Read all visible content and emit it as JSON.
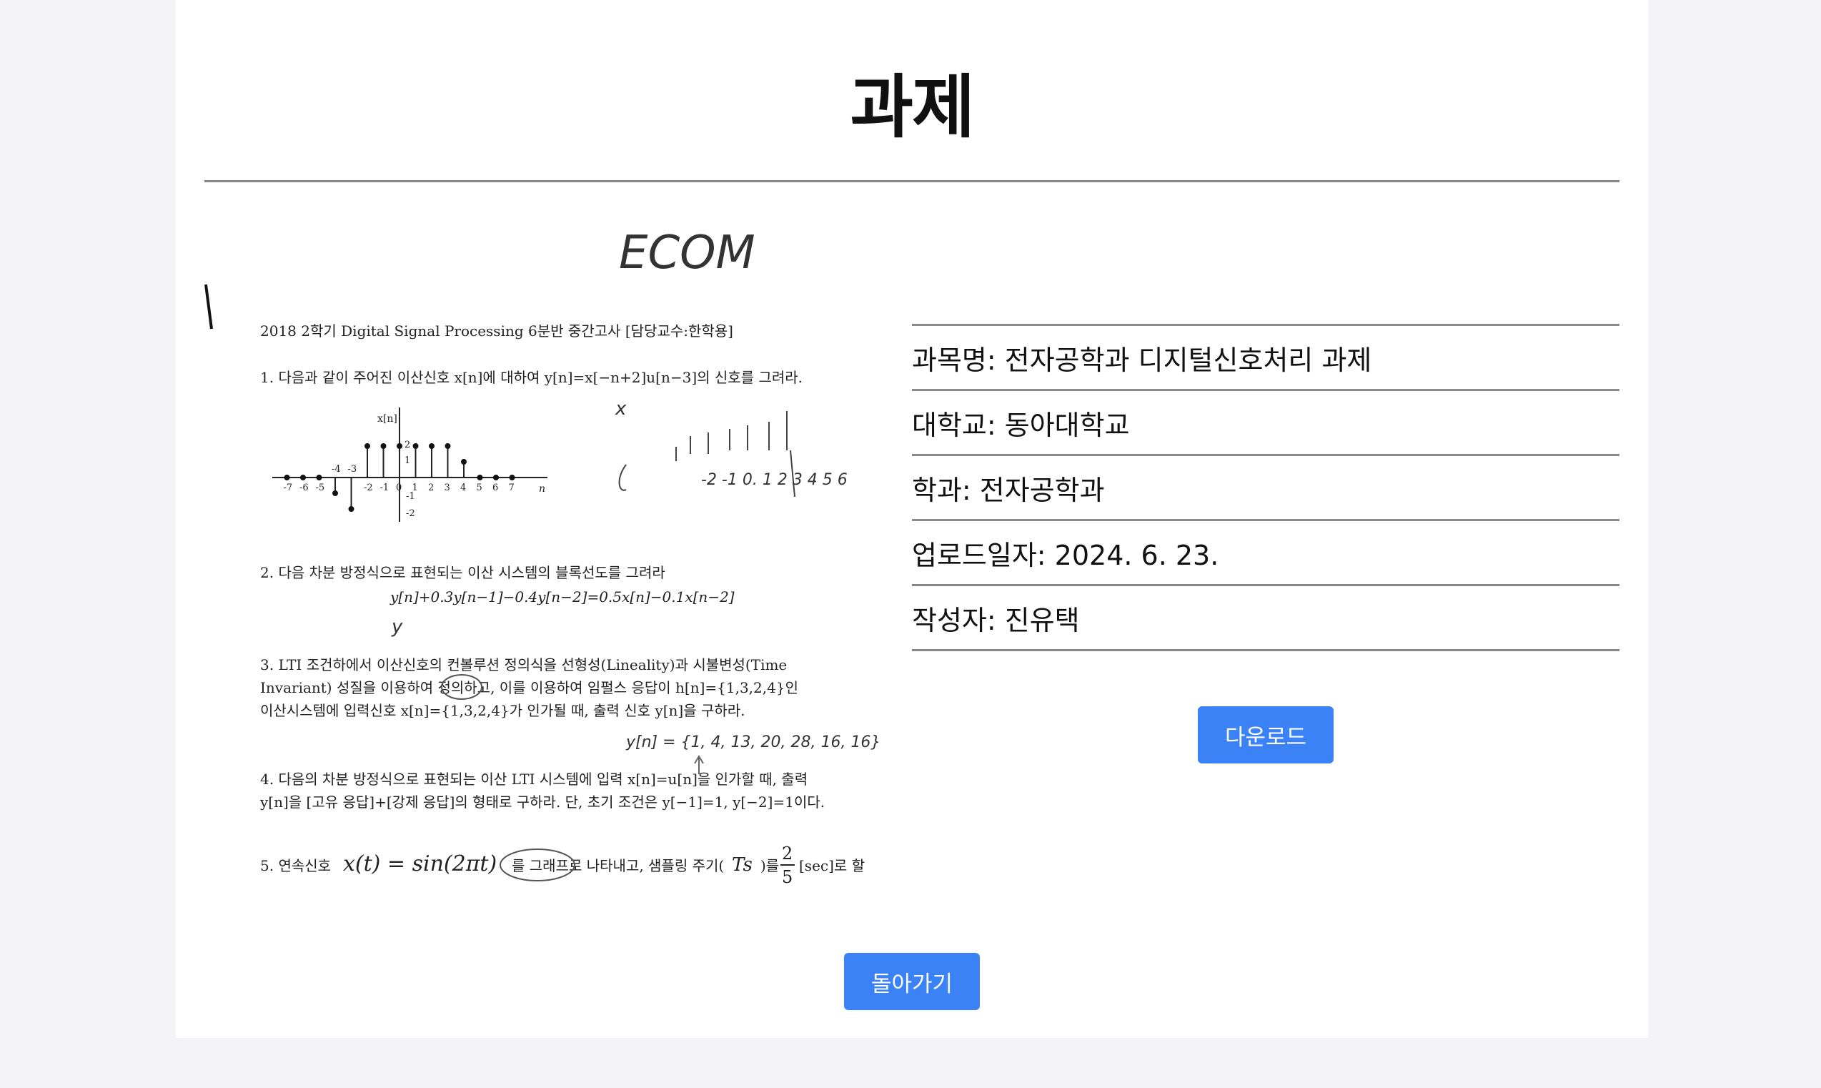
{
  "page": {
    "title": "과제"
  },
  "document": {
    "handwritten_header": "ECOM",
    "exam_title": "2018 2학기 Digital Signal Processing 6분반 중간고사 [담당교수:한학용]",
    "q1": "1. 다음과 같이 주어진 이산신호 x[n]에 대하여 y[n]=x[−n+2]u[n−3]의 신호를 그려라.",
    "q1_axis_label": "x[n]",
    "q1_axis_n": "n",
    "q1_ticks": [
      "-7",
      "-6",
      "-5",
      "-4",
      "-3",
      "-2",
      "-1",
      "0",
      "1",
      "2",
      "3",
      "4",
      "5",
      "6",
      "7"
    ],
    "q1_yticks": [
      "2",
      "1",
      "-1",
      "-2"
    ],
    "q1_hand_x": "x",
    "q1_hand_ticks": "-2 -1 0. 1 2 3 4 5 6",
    "q2": "2. 다음 차분 방정식으로 표현되는 이산 시스템의 블록선도를 그려라",
    "q2_eq": "y[n]+0.3y[n−1]−0.4y[n−2]=0.5x[n]−0.1x[n−2]",
    "q2_hand": "y",
    "q3_l1": "3. LTI 조건하에서 이산신호의 컨볼루션 정의식을 선형성(Lineality)과 시불변성(Time",
    "q3_l2": "Invariant) 성질을 이용하여 정의하고, 이를 이용하여 임펄스 응답이 h[n]={1,3,2,4}인",
    "q3_l3": "이산시스템에 입력신호 x[n]={1,3,2,4}가 인가될 때, 출력 신호 y[n]을 구하라.",
    "q3_hand": "y[n] = {1, 4, 13, 20, 28, 16, 16}",
    "q4_l1": "4. 다음의 차분 방정식으로 표현되는 이산 LTI 시스템에 입력 x[n]=u[n]을 인가할 때, 출력",
    "q4_l2": "y[n]을 [고유 응답]+[강제 응답]의 형태로 구하라. 단, 초기 조건은 y[−1]=1, y[−2]=1이다.",
    "q5_a": "5. 연속신호",
    "q5_eq": "x(t) = sin(2πt)",
    "q5_b": "를 그래프로 나타내고, 샘플링 주기(",
    "q5_ts": "Ts",
    "q5_c": ")를",
    "q5_num": "2",
    "q5_den": "5",
    "q5_d": "[sec]로 할"
  },
  "details": {
    "subject": "과목명: 전자공학과 디지털신호처리 과제",
    "university": "대학교: 동아대학교",
    "department": "학과: 전자공학과",
    "upload_date": "업로드일자: 2024. 6. 23.",
    "author": "작성자: 진유택"
  },
  "buttons": {
    "download": "다운로드",
    "back": "돌아가기"
  },
  "colors": {
    "accent": "#3b82f6",
    "background": "#f4f4f8",
    "card": "#ffffff",
    "rule": "#8a8a8a"
  }
}
